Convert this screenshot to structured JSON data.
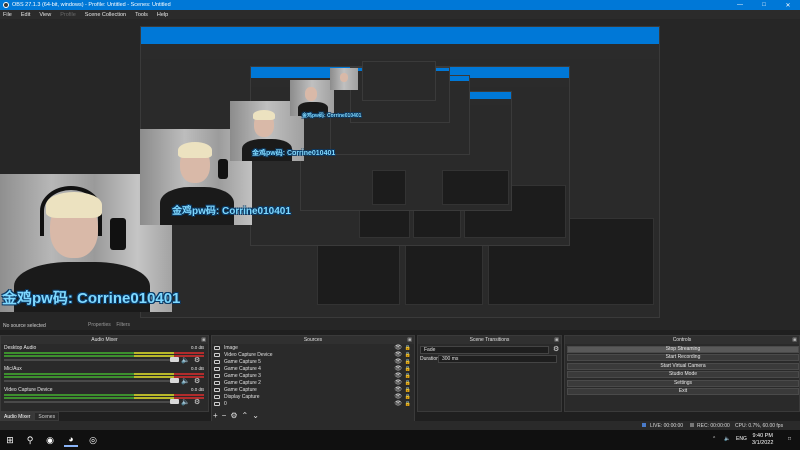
{
  "window": {
    "title": "OBS 27.1.3 (64-bit, windows) - Profile: Untitled - Scenes: Untitled"
  },
  "menu": [
    {
      "label": "File",
      "enabled": true
    },
    {
      "label": "Edit",
      "enabled": true
    },
    {
      "label": "View",
      "enabled": true
    },
    {
      "label": "Profile",
      "enabled": false
    },
    {
      "label": "Scene Collection",
      "enabled": true
    },
    {
      "label": "Tools",
      "enabled": true
    },
    {
      "label": "Help",
      "enabled": true
    }
  ],
  "preview": {
    "overlay_text": "金鸡pw码: Corrine010401",
    "no_source": "No source selected",
    "properties": "Properties",
    "filters": "Filters"
  },
  "audio_mixer": {
    "title": "Audio Mixer",
    "channels": [
      {
        "name": "Desktop Audio",
        "db": "0.0 dB",
        "level": 0.85
      },
      {
        "name": "Mic/Aux",
        "db": "0.0 dB",
        "level": 0.85
      },
      {
        "name": "Video Capture Device",
        "db": "0.0 dB",
        "level": 0.85
      }
    ]
  },
  "dock_tabs": [
    "Audio Mixer",
    "Scenes"
  ],
  "sources": {
    "title": "Sources",
    "items": [
      "Image",
      "Video Capture Device",
      "Game Capture 5",
      "Game Capture 4",
      "Game Capture 3",
      "Game Capture 2",
      "Game Capture",
      "Display Capture",
      "0"
    ]
  },
  "transitions": {
    "title": "Scene Transitions",
    "type": "Fade",
    "duration_label": "Duration",
    "duration": "300 ms"
  },
  "controls": {
    "title": "Controls",
    "buttons": [
      "Stop Streaming",
      "Start Recording",
      "Start Virtual Camera",
      "Studio Mode",
      "Settings",
      "Exit"
    ]
  },
  "status": {
    "live": "LIVE: 00:00:00",
    "rec": "REC: 00:00:00",
    "cpu": "CPU: 0.7%, 60.00 fps"
  },
  "taskbar": {
    "lang": "ENG",
    "time": "9:40 PM",
    "date": "3/1/2022"
  },
  "colors": {
    "accent": "#0078d7",
    "overlay_text": "#7fd9ff",
    "meter_green": "#3f9b2f",
    "meter_yellow": "#c8c82a",
    "meter_red": "#c02c2c"
  }
}
